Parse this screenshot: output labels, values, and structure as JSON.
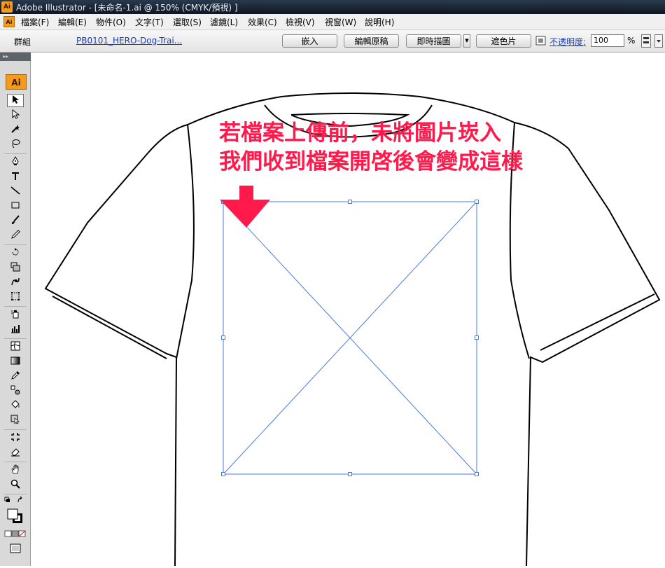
{
  "window": {
    "app_icon": "Ai",
    "title": "Adobe Illustrator - [未命名-1.ai @ 150% (CMYK/預視) ]"
  },
  "menubar": {
    "doc_icon": "Ai",
    "items": [
      "檔案(F)",
      "編輯(E)",
      "物件(O)",
      "文字(T)",
      "選取(S)",
      "濾鏡(L)",
      "效果(C)",
      "檢視(V)",
      "視窗(W)",
      "說明(H)"
    ]
  },
  "controlbar": {
    "selection": "群組",
    "file_name": "PB0101_HERO-Dog-Trai...",
    "embed_button": "嵌入",
    "edit_original_button": "編輯原稿",
    "live_trace_button": "即時描圖",
    "mask_button": "遮色片",
    "opacity_label": "不透明度:",
    "opacity_value": "100",
    "opacity_unit": "%"
  },
  "tools": {
    "logo": "Ai",
    "items": [
      {
        "name": "selection-tool",
        "icon": "selection-arrow-icon"
      },
      {
        "name": "direct-selection-tool",
        "icon": "direct-selection-icon"
      },
      {
        "name": "magic-wand-tool",
        "icon": "magic-wand-icon"
      },
      {
        "name": "lasso-tool",
        "icon": "lasso-icon"
      },
      {
        "name": "pen-tool",
        "icon": "pen-icon"
      },
      {
        "name": "type-tool",
        "icon": "type-icon"
      },
      {
        "name": "line-tool",
        "icon": "line-icon"
      },
      {
        "name": "rectangle-tool",
        "icon": "rectangle-icon"
      },
      {
        "name": "paintbrush-tool",
        "icon": "brush-icon"
      },
      {
        "name": "pencil-tool",
        "icon": "pencil-icon"
      },
      {
        "name": "rotate-tool",
        "icon": "rotate-icon"
      },
      {
        "name": "scale-tool",
        "icon": "scale-icon"
      },
      {
        "name": "warp-tool",
        "icon": "warp-icon"
      },
      {
        "name": "free-transform-tool",
        "icon": "free-transform-icon"
      },
      {
        "name": "symbol-sprayer-tool",
        "icon": "symbol-sprayer-icon"
      },
      {
        "name": "column-graph-tool",
        "icon": "column-graph-icon"
      },
      {
        "name": "mesh-tool",
        "icon": "mesh-icon"
      },
      {
        "name": "gradient-tool",
        "icon": "gradient-icon"
      },
      {
        "name": "eyedropper-tool",
        "icon": "eyedropper-icon"
      },
      {
        "name": "blend-tool",
        "icon": "blend-icon"
      },
      {
        "name": "live-paint-bucket-tool",
        "icon": "paint-bucket-icon"
      },
      {
        "name": "live-paint-selection-tool",
        "icon": "live-paint-selection-icon"
      },
      {
        "name": "crop-area-tool",
        "icon": "crop-area-icon"
      },
      {
        "name": "eraser-tool",
        "icon": "eraser-icon"
      },
      {
        "name": "hand-tool",
        "icon": "hand-icon"
      },
      {
        "name": "zoom-tool",
        "icon": "zoom-icon"
      }
    ]
  },
  "annotation": {
    "line1": "若檔案上傳前，未將圖片崁入",
    "line2": "我們收到檔案開啓後會變成這樣",
    "color": "#ff1a4b"
  },
  "colors": {
    "selection_blue": "#4a7bdc",
    "accent_red": "#ff1a4b",
    "ai_orange": "#f29b1e"
  }
}
